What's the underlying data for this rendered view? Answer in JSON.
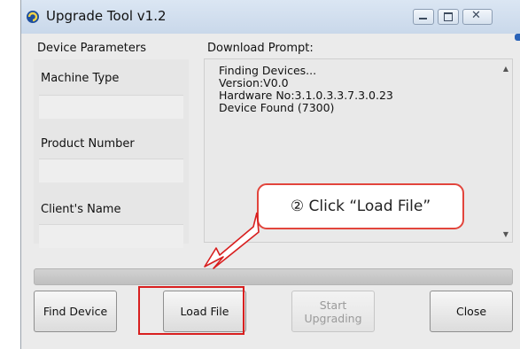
{
  "window": {
    "title": "Upgrade Tool v1.2",
    "app_icon": "app-logo-icon",
    "controls": {
      "minimize": "minimize-icon",
      "maximize": "maximize-icon",
      "close": "close-icon"
    }
  },
  "left_panel": {
    "heading": "Device Parameters",
    "fields": [
      {
        "label": "Machine Type",
        "value": ""
      },
      {
        "label": "Product Number",
        "value": ""
      },
      {
        "label": "Client's Name",
        "value": ""
      }
    ]
  },
  "download_prompt": {
    "heading": "Download Prompt:",
    "lines": [
      "Finding Devices...",
      "Version:V0.0",
      "Hardware No:3.1.0.3.3.7.3.0.23",
      "Device Found (7300)"
    ]
  },
  "progress": {
    "fraction": 0.0
  },
  "buttons": {
    "find_device": "Find Device",
    "load_file": "Load File",
    "start_upgrading": "Start Upgrading",
    "close": "Close"
  },
  "annotation": {
    "callout_text": "② Click “Load File”",
    "color": "#d81f1f"
  }
}
